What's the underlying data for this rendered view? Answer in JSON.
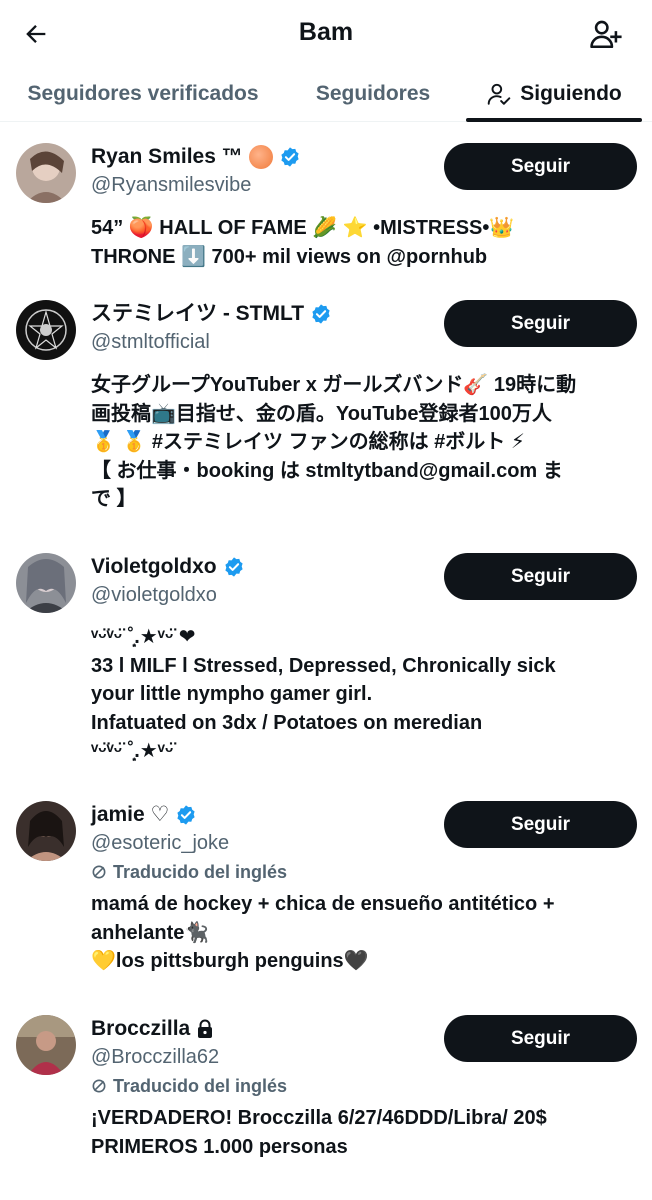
{
  "header": {
    "title": "Bam",
    "back_icon": "arrow-left-icon",
    "add_icon": "add-user-icon"
  },
  "tabs": [
    {
      "label": "Seguidores verificados",
      "active": false
    },
    {
      "label": "Seguidores",
      "active": false
    },
    {
      "label": "Siguiendo",
      "active": true,
      "icon": "user-check-icon"
    }
  ],
  "colors": {
    "text": "#0f1419",
    "muted": "#536471",
    "verified": "#1d9bf0",
    "button_bg": "#0f1419",
    "divider": "#eff3f4"
  },
  "users": [
    {
      "name": "Ryan Smiles ™",
      "handle": "@Ryansmilesvibe",
      "badge": "verified",
      "button": "Seguir",
      "translated": "",
      "bio": [
        "54” 🍑 HALL OF FAME 🌽 ⭐ •MISTRESS•👑",
        "THRONE ⬇️ 700+ mil views on @pornhub"
      ]
    },
    {
      "name": "ステミレイツ - STMLT",
      "handle": "@stmltofficial",
      "badge": "verified",
      "button": "Seguir",
      "translated": "",
      "bio": [
        "女子グループYouTuber x ガールズバンド🎸 19時に動",
        "画投稿📺目指せ、金の盾。YouTube登録者100万人",
        "🥇 🥇 #ステミレイツ ファンの総称は #ボルト ⚡",
        "【 お仕事・booking は stmltytband@gmail.com ま",
        "で 】"
      ]
    },
    {
      "name": "Violetgoldxo",
      "handle": "@violetgoldxo",
      "badge": "verified",
      "button": "Seguir",
      "translated": "",
      "bio": [
        "ᵛᵕ̈ᵛᵕ̈ ˚̣̣̣͙.★ᵛᵕ̈ ❤",
        " 33 l MILF l Stressed, Depressed, Chronically sick",
        "your little nympho gamer girl.",
        "Infatuated on 3dx / Potatoes on meredian",
        "ᵛᵕ̈ᵛᵕ̈ ˚̣̣̣͙.★ᵛᵕ̈"
      ]
    },
    {
      "name": "jamie ♡",
      "handle": "@esoteric_joke",
      "badge": "verified",
      "button": "Seguir",
      "translated": "Traducido del inglés",
      "bio": [
        "mamá de hockey + chica de ensueño antitético +",
        "anhelante🐈‍⬛",
        "💛los pittsburgh penguins🖤"
      ]
    },
    {
      "name": "Brocczilla",
      "handle": "@Brocczilla62",
      "badge": "lock",
      "button": "Seguir",
      "translated": "Traducido del inglés",
      "bio": [
        "¡VERDADERO! Brocczilla 6/27/46DDD/Libra/ 20$",
        "PRIMEROS 1.000 personas"
      ]
    }
  ]
}
